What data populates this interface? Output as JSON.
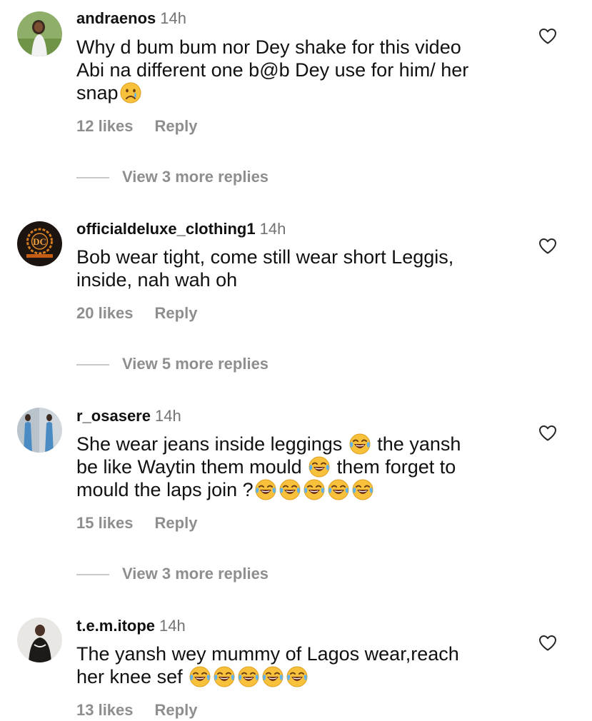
{
  "comments": [
    {
      "username": "andraenos",
      "time": "14h",
      "lines": [
        "Why d bum bum nor Dey shake for this video",
        "Abi na different one b@b Dey use for him/ her",
        "snap"
      ],
      "likes": "12 likes",
      "reply_label": "Reply",
      "view_replies": "View 3 more replies"
    },
    {
      "username": "officialdeluxe_clothing1",
      "time": "14h",
      "lines": [
        "Bob wear tight, come still wear short Leggis,",
        "inside, nah wah oh"
      ],
      "likes": "20 likes",
      "reply_label": "Reply",
      "view_replies": "View 5 more replies",
      "avatar_text": "DELUXE CLOTHING"
    },
    {
      "username": "r_osasere",
      "time": "14h",
      "lines": [
        "She wear jeans inside leggings",
        "the yansh",
        "be like Waytin them mould",
        "them forget to",
        "mould the laps join ?"
      ],
      "likes": "15 likes",
      "reply_label": "Reply",
      "view_replies": "View 3 more replies"
    },
    {
      "username": "t.e.m.itope",
      "time": "14h",
      "lines": [
        "The yansh wey mummy of Lagos wear,reach",
        "her knee sef"
      ],
      "likes": "13 likes",
      "reply_label": "Reply"
    }
  ],
  "icons": {
    "like": "heart-outline-icon",
    "crying_emoji": "crying-face-emoji",
    "laughing_emoji": "tears-of-joy-emoji"
  },
  "colors": {
    "text": "#111111",
    "secondary": "#8e8e8e",
    "timestamp": "#737373",
    "emoji_yellow": "#f7c13c"
  }
}
